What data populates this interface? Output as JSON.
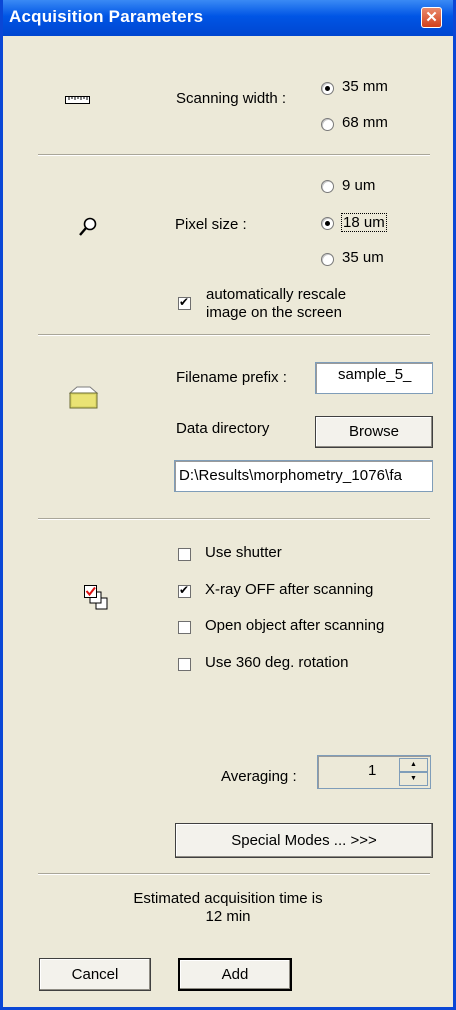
{
  "window": {
    "title": "Acquisition Parameters",
    "close_glyph": "✕"
  },
  "scanning": {
    "label": "Scanning width :",
    "options": [
      {
        "label": "35 mm",
        "selected": true
      },
      {
        "label": "68 mm",
        "selected": false
      }
    ],
    "icon": "ruler-icon"
  },
  "pixel": {
    "label": "Pixel size :",
    "options": [
      {
        "label": "9 um",
        "selected": false
      },
      {
        "label": "18 um",
        "selected": true
      },
      {
        "label": "35 um",
        "selected": false
      }
    ],
    "rescale": {
      "line1": "automatically rescale",
      "line2": "image on the screen",
      "checked": true
    },
    "icon": "magnifier-icon"
  },
  "files": {
    "prefix_label": "Filename prefix :",
    "prefix_value": "sample_5_",
    "dir_label": "Data directory",
    "browse_label": "Browse",
    "dir_value": "D:\\Results\\morphometry_1076\\fa",
    "icon": "folder-icon"
  },
  "options": {
    "icon": "checkbox-options-icon",
    "items": [
      {
        "label": "Use shutter",
        "checked": false
      },
      {
        "label": "X-ray OFF after scanning",
        "checked": true
      },
      {
        "label": "Open object after scanning",
        "checked": false
      },
      {
        "label": "Use 360 deg. rotation",
        "checked": false
      }
    ]
  },
  "averaging": {
    "label": "Averaging :",
    "value": "1",
    "up": "▲",
    "down": "▼"
  },
  "special_modes_label": "Special Modes ... >>>",
  "estimate": {
    "line1": "Estimated acquisition time is",
    "line2": "12 min"
  },
  "footer": {
    "cancel": "Cancel",
    "add": "Add"
  },
  "colors": {
    "titlebar": "#0055e5",
    "dialog_bg": "#ece9d8",
    "close": "#d2401c"
  }
}
